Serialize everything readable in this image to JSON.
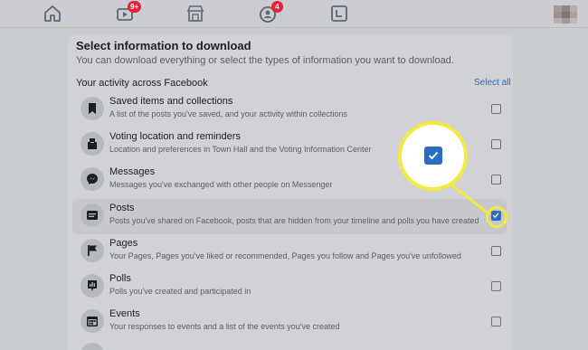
{
  "nav": {
    "home_icon": "home-icon",
    "watch_badge": "9+",
    "marketplace_icon": "marketplace-icon",
    "groups_badge": "4",
    "gaming_icon": "gaming-icon"
  },
  "panel": {
    "title": "Select information to download",
    "subtitle": "You can download everything or select the types of information you want to download.",
    "section_heading": "Your activity across Facebook",
    "select_all": "Select all"
  },
  "items": [
    {
      "label": "Saved items and collections",
      "desc": "A list of the posts you've saved, and your activity within collections",
      "icon": "bookmark-icon",
      "checked": false
    },
    {
      "label": "Voting location and reminders",
      "desc": "Location and preferences in Town Hall and the Voting Information Center",
      "icon": "ballot-box-icon",
      "checked": false
    },
    {
      "label": "Messages",
      "desc": "Messages you've exchanged with other people on Messenger",
      "icon": "messenger-icon",
      "checked": false
    },
    {
      "label": "Posts",
      "desc": "Posts you've shared on Facebook, posts that are hidden from your timeline and polls you have created",
      "icon": "posts-icon",
      "checked": true
    },
    {
      "label": "Pages",
      "desc": "Your Pages, Pages you've liked or recommended, Pages you follow and Pages you've unfollowed",
      "icon": "flag-icon",
      "checked": false
    },
    {
      "label": "Polls",
      "desc": "Polls you've created and participated in",
      "icon": "poll-icon",
      "checked": false
    },
    {
      "label": "Events",
      "desc": "Your responses to events and a list of the events you've created",
      "icon": "calendar-icon",
      "checked": false
    }
  ],
  "colors": {
    "accent": "#2a6dc1",
    "highlight": "#f2ea3c",
    "badge": "#e0243a"
  }
}
